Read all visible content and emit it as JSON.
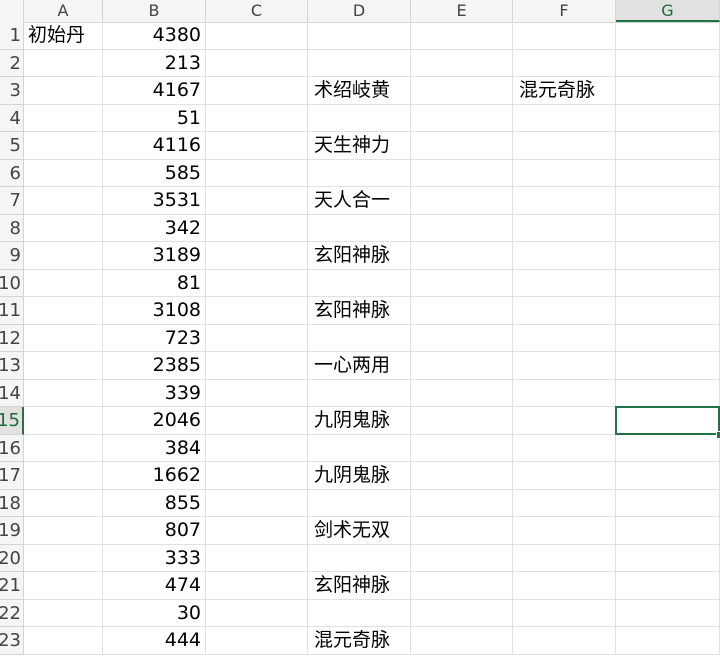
{
  "columns": [
    "A",
    "B",
    "C",
    "D",
    "E",
    "F",
    "G"
  ],
  "selected_column": "G",
  "selected_row": 15,
  "rows": [
    {
      "n": "1",
      "A": "初始丹",
      "B": "4380",
      "D": "",
      "F": ""
    },
    {
      "n": "2",
      "A": "",
      "B": "213",
      "D": "",
      "F": ""
    },
    {
      "n": "3",
      "A": "",
      "B": "4167",
      "D": "术绍岐黄",
      "F": "混元奇脉"
    },
    {
      "n": "4",
      "A": "",
      "B": "51",
      "D": "",
      "F": ""
    },
    {
      "n": "5",
      "A": "",
      "B": "4116",
      "D": "天生神力",
      "F": ""
    },
    {
      "n": "6",
      "A": "",
      "B": "585",
      "D": "",
      "F": ""
    },
    {
      "n": "7",
      "A": "",
      "B": "3531",
      "D": "天人合一",
      "F": ""
    },
    {
      "n": "8",
      "A": "",
      "B": "342",
      "D": "",
      "F": ""
    },
    {
      "n": "9",
      "A": "",
      "B": "3189",
      "D": "玄阳神脉",
      "F": ""
    },
    {
      "n": "10",
      "A": "",
      "B": "81",
      "D": "",
      "F": ""
    },
    {
      "n": "11",
      "A": "",
      "B": "3108",
      "D": "玄阳神脉",
      "F": ""
    },
    {
      "n": "12",
      "A": "",
      "B": "723",
      "D": "",
      "F": ""
    },
    {
      "n": "13",
      "A": "",
      "B": "2385",
      "D": "一心两用",
      "F": ""
    },
    {
      "n": "14",
      "A": "",
      "B": "339",
      "D": "",
      "F": ""
    },
    {
      "n": "15",
      "A": "",
      "B": "2046",
      "D": "九阴鬼脉",
      "F": ""
    },
    {
      "n": "16",
      "A": "",
      "B": "384",
      "D": "",
      "F": ""
    },
    {
      "n": "17",
      "A": "",
      "B": "1662",
      "D": "九阴鬼脉",
      "F": ""
    },
    {
      "n": "18",
      "A": "",
      "B": "855",
      "D": "",
      "F": ""
    },
    {
      "n": "19",
      "A": "",
      "B": "807",
      "D": "剑术无双",
      "F": ""
    },
    {
      "n": "20",
      "A": "",
      "B": "333",
      "D": "",
      "F": ""
    },
    {
      "n": "21",
      "A": "",
      "B": "474",
      "D": "玄阳神脉",
      "F": ""
    },
    {
      "n": "22",
      "A": "",
      "B": "30",
      "D": "",
      "F": ""
    },
    {
      "n": "23",
      "A": "",
      "B": "444",
      "D": "混元奇脉",
      "F": ""
    }
  ],
  "colors": {
    "accent": "#217346",
    "gridline": "#e1e1e1",
    "header_bg": "#f5f5f5"
  }
}
